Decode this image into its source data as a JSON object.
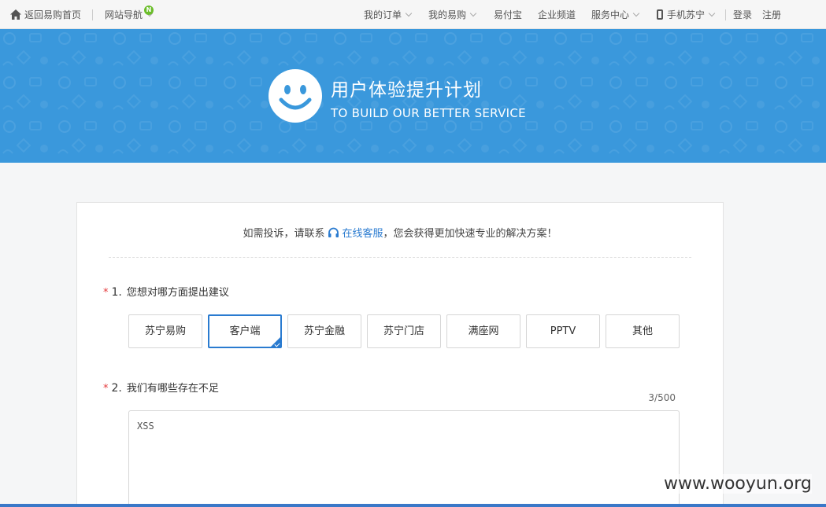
{
  "topnav": {
    "home": "返回易购首页",
    "site_nav": "网站导航",
    "site_nav_badge": "N",
    "my_orders": "我的订单",
    "my_yigou": "我的易购",
    "yifubao": "易付宝",
    "enterprise": "企业频道",
    "service_center": "服务中心",
    "mobile": "手机苏宁",
    "login": "登录",
    "register": "注册"
  },
  "banner": {
    "title": "用户体验提升计划",
    "subtitle": "TO BUILD OUR BETTER SERVICE"
  },
  "notice": {
    "prefix": "如需投诉，请联系",
    "link": "在线客服",
    "suffix": "，您会获得更加快速专业的解决方案！"
  },
  "questions": [
    {
      "star": "*",
      "number": "1.",
      "text": "您想对哪方面提出建议"
    },
    {
      "star": "*",
      "number": "2.",
      "text": "我们有哪些存在不足"
    }
  ],
  "options": [
    {
      "label": "苏宁易购",
      "selected": false
    },
    {
      "label": "客户端",
      "selected": true
    },
    {
      "label": "苏宁金融",
      "selected": false
    },
    {
      "label": "苏宁门店",
      "selected": false
    },
    {
      "label": "满座网",
      "selected": false
    },
    {
      "label": "PPTV",
      "selected": false
    },
    {
      "label": "其他",
      "selected": false
    }
  ],
  "feedback": {
    "value": "XSS",
    "counter": "3/500"
  },
  "watermark": "www.wooyun.org",
  "colors": {
    "banner_bg": "#3a98dc",
    "link": "#2a7bd0",
    "required": "#e4393c",
    "badge": "#6bbd2a"
  }
}
